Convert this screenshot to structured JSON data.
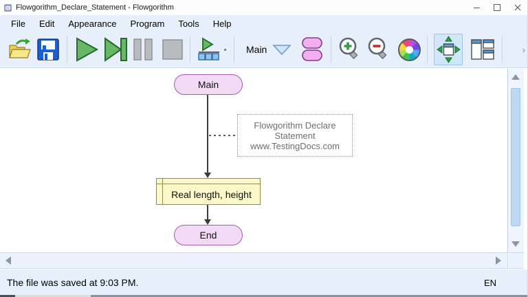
{
  "window": {
    "title": "Flowgorithm_Declare_Statement - Flowgorithm",
    "controls": {
      "minimize": "minimize",
      "maximize": "maximize",
      "close": "close"
    }
  },
  "menu": {
    "items": [
      "File",
      "Edit",
      "Appearance",
      "Program",
      "Tools",
      "Help"
    ]
  },
  "toolbar": {
    "function_selector": {
      "value": "Main"
    },
    "overflow_chevron": "›",
    "buttons": [
      {
        "name": "open",
        "icon": "open-folder-icon"
      },
      {
        "name": "save",
        "icon": "save-floppy-icon"
      },
      {
        "name": "run",
        "icon": "play-icon"
      },
      {
        "name": "step",
        "icon": "step-forward-icon"
      },
      {
        "name": "pause",
        "icon": "pause-icon"
      },
      {
        "name": "stop",
        "icon": "stop-icon"
      },
      {
        "name": "run-options",
        "icon": "play-blocks-icon"
      },
      {
        "name": "function-manager",
        "icon": "function-shapes-icon"
      },
      {
        "name": "zoom-in",
        "icon": "zoom-in-icon"
      },
      {
        "name": "zoom-out",
        "icon": "zoom-out-icon"
      },
      {
        "name": "chart-colors",
        "icon": "color-wheel-icon"
      },
      {
        "name": "fit-to-window",
        "icon": "fit-arrows-icon",
        "selected": true
      },
      {
        "name": "window-layout",
        "icon": "window-layout-icon"
      }
    ]
  },
  "flowchart": {
    "start_label": "Main",
    "declare_label": "Real length, height",
    "end_label": "End",
    "comment": {
      "lines": [
        "Flowgorithm Declare",
        "Statement",
        "www.TestingDocs.com"
      ]
    }
  },
  "statusbar": {
    "message": "The file was saved at 9:03 PM.",
    "language_indicator": "EN"
  },
  "colors": {
    "chrome_background": "#e6effa",
    "terminal_fill": "#f2daf5",
    "terminal_border": "#a35bb5",
    "declare_fill": "#fbf7c9",
    "declare_border": "#8f8c50",
    "comment_text": "#6e6e6e",
    "flow_line": "#3c3c3c",
    "scroll_thumb": "#bcd8f3",
    "selected_button_bg": "#d0e7f9"
  }
}
